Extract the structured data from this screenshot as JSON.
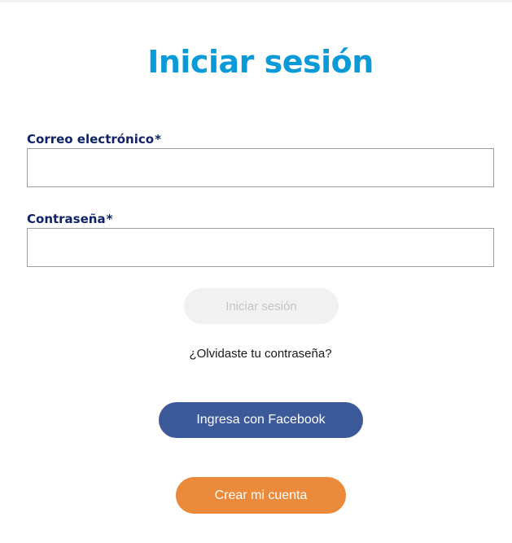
{
  "colors": {
    "title": "#0a9ad8",
    "label": "#0f2265",
    "login_button_bg": "#f1f1f1",
    "login_button_text": "#c4c4c4",
    "facebook_button_bg": "#3c599a",
    "create_button_bg": "#eb8a3a",
    "button_text": "#ffffff"
  },
  "page": {
    "title": "Iniciar sesión"
  },
  "form": {
    "email": {
      "label": "Correo electrónico",
      "required_mark": "*",
      "value": "",
      "placeholder": ""
    },
    "password": {
      "label": "Contraseña",
      "required_mark": "*",
      "value": "",
      "placeholder": ""
    },
    "login_label": "Iniciar sesión",
    "forgot_label": "¿Olvidaste tu contraseña?"
  },
  "social": {
    "facebook_label": "Ingresa con Facebook"
  },
  "signup": {
    "create_account_label": "Crear mi cuenta"
  }
}
